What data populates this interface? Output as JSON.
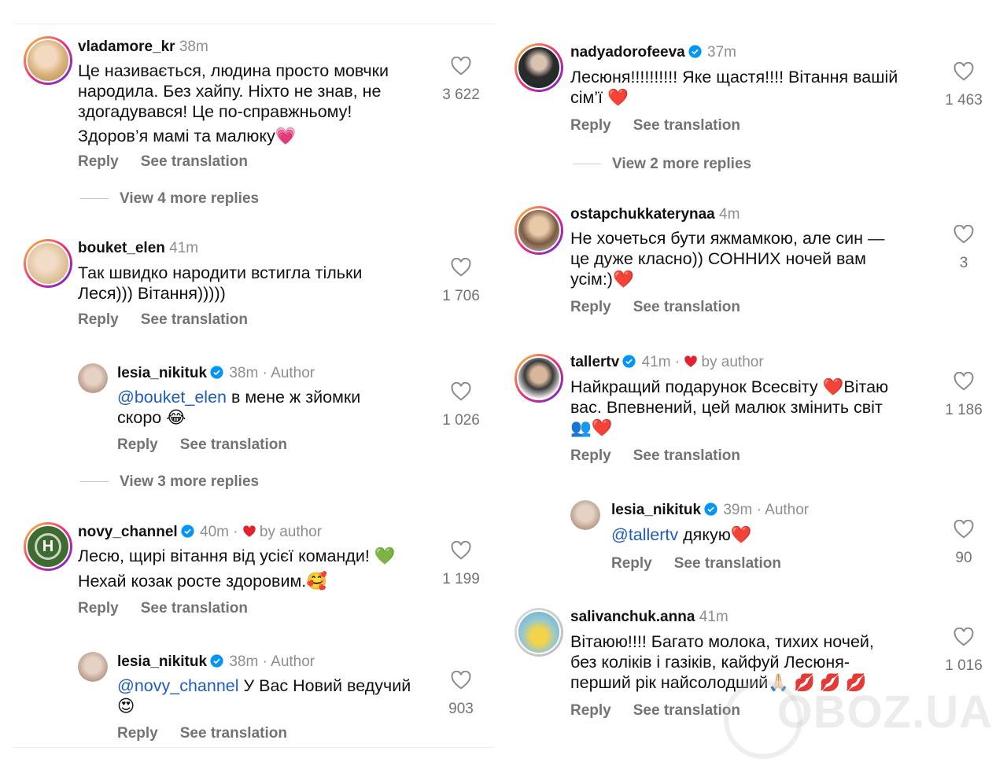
{
  "left": [
    {
      "username": "vladamore_kr",
      "time": "38m",
      "verified": false,
      "lines": [
        "Це називається, людина просто мовчки",
        "народила. Без хайпу. Ніхто не знав, не",
        "здогадувався! Це по-справжньому!",
        "Здоров’я мамі та малюку💗"
      ],
      "likes": "3 622",
      "reply": "Reply",
      "see_translation": "See translation",
      "more_replies": "View 4 more replies"
    },
    {
      "username": "bouket_elen",
      "time": "41m",
      "verified": false,
      "lines": [
        "Так швидко народити встигла тільки",
        "Леся))) Вітання)))))"
      ],
      "likes": "1 706",
      "reply": "Reply",
      "see_translation": "See translation"
    },
    {
      "username": "lesia_nikituk",
      "time": "38m",
      "sep": "·",
      "author": "Author",
      "verified": true,
      "mention": "@bouket_elen",
      "lines": [
        " в мене ж зйомки",
        "скоро 😂"
      ],
      "likes": "1 026",
      "reply": "Reply",
      "see_translation": "See translation",
      "more_replies": "View 3 more replies"
    },
    {
      "username": "novy_channel",
      "time": "40m",
      "sep": "·",
      "by_author": "by author",
      "verified": true,
      "avatar_letter": "H",
      "lines": [
        "Лесю, щирі вітання від усієї команди! 💚",
        "Нехай козак росте здоровим.🥰"
      ],
      "likes": "1 199",
      "reply": "Reply",
      "see_translation": "See translation"
    },
    {
      "username": "lesia_nikituk",
      "time": "38m",
      "sep": "·",
      "author": "Author",
      "verified": true,
      "mention": "@novy_channel",
      "lines": [
        " У Вас Новий ведучий",
        "😍"
      ],
      "likes": "903",
      "reply": "Reply",
      "see_translation": "See translation"
    }
  ],
  "right": [
    {
      "username": "nadyadorofeeva",
      "time": "37m",
      "verified": true,
      "lines": [
        "Лесюня!!!!!!!!!! Яке щастя!!!! Вітання вашій",
        "сім’ї ❤️"
      ],
      "likes": "1 463",
      "reply": "Reply",
      "see_translation": "See translation",
      "more_replies": "View 2 more replies"
    },
    {
      "username": "ostapchukkaterynaa",
      "time": "4m",
      "verified": false,
      "lines": [
        "Не хочеться бути яжмамкою, але син —",
        "це дуже класно)) СОННИХ ночей вам",
        "усім:)❤️"
      ],
      "likes": "3",
      "reply": "Reply",
      "see_translation": "See translation"
    },
    {
      "username": "tallertv",
      "time": "41m",
      "sep": "·",
      "by_author": "by author",
      "verified": true,
      "lines": [
        "Найкращий подарунок Всесвіту ❤️Вітаю",
        "вас. Впевнений, цей малюк змінить світ",
        "👥❤️"
      ],
      "likes": "1 186",
      "reply": "Reply",
      "see_translation": "See translation"
    },
    {
      "username": "lesia_nikituk",
      "time": "39m",
      "sep": "·",
      "author": "Author",
      "verified": true,
      "mention": "@tallertv",
      "lines": [
        " дякую❤️"
      ],
      "likes": "90",
      "reply": "Reply",
      "see_translation": "See translation"
    },
    {
      "username": "salivanchuk.anna",
      "time": "41m",
      "verified": false,
      "lines": [
        "Вітаюю!!!! Багато молока, тихих ночей,",
        "без коліків і газіків, кайфуй Лесюня-",
        "перший рік найсолодший🙏🏻 💋 💋 💋"
      ],
      "likes": "1 016",
      "reply": "Reply",
      "see_translation": "See translation"
    }
  ],
  "watermark": "OBOZ.UA",
  "colors": {
    "mention": "#1f5bbd",
    "muted": "#737373",
    "verified": "#0095f6",
    "heart": "#e3212f"
  },
  "icons": {
    "like": "heart-outline-icon",
    "verified": "verified-badge-icon",
    "author_heart": "red-heart-icon"
  }
}
